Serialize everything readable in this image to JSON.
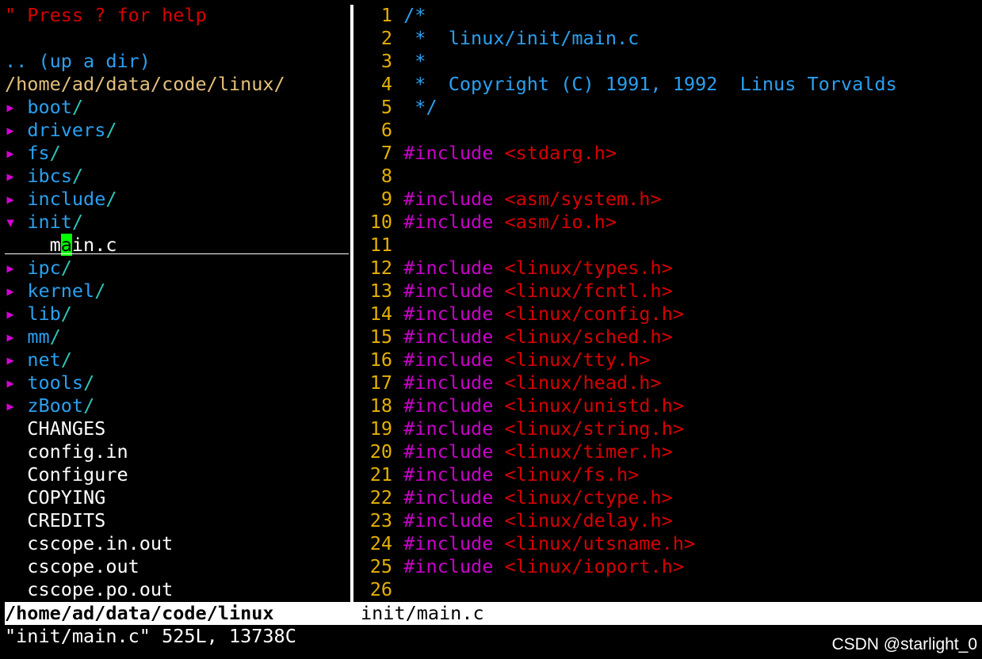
{
  "tree": {
    "help": "\" Press ? for help",
    "up_dir": ".. (up a dir)",
    "root_path": "/home/ad/data/code/linux/",
    "arrow_collapsed": "▸",
    "arrow_expanded": "▾",
    "entries": [
      {
        "kind": "dir",
        "name": "boot",
        "arrow": "▸"
      },
      {
        "kind": "dir",
        "name": "drivers",
        "arrow": "▸"
      },
      {
        "kind": "dir",
        "name": "fs",
        "arrow": "▸"
      },
      {
        "kind": "dir",
        "name": "ibcs",
        "arrow": "▸"
      },
      {
        "kind": "dir",
        "name": "include",
        "arrow": "▸"
      },
      {
        "kind": "dir",
        "name": "init",
        "arrow": "▾"
      },
      {
        "kind": "child",
        "name_pre": "m",
        "name_cursor": "a",
        "name_post": "in.c"
      },
      {
        "kind": "dir",
        "name": "ipc",
        "arrow": "▸"
      },
      {
        "kind": "dir",
        "name": "kernel",
        "arrow": "▸"
      },
      {
        "kind": "dir",
        "name": "lib",
        "arrow": "▸"
      },
      {
        "kind": "dir",
        "name": "mm",
        "arrow": "▸"
      },
      {
        "kind": "dir",
        "name": "net",
        "arrow": "▸"
      },
      {
        "kind": "dir",
        "name": "tools",
        "arrow": "▸"
      },
      {
        "kind": "dir",
        "name": "zBoot",
        "arrow": "▸"
      },
      {
        "kind": "file",
        "name": "CHANGES"
      },
      {
        "kind": "file",
        "name": "config.in"
      },
      {
        "kind": "file",
        "name": "Configure"
      },
      {
        "kind": "file",
        "name": "COPYING"
      },
      {
        "kind": "file",
        "name": "CREDITS"
      },
      {
        "kind": "file",
        "name": "cscope.in.out"
      },
      {
        "kind": "file",
        "name": "cscope.out"
      },
      {
        "kind": "file",
        "name": "cscope.po.out"
      }
    ]
  },
  "editor": {
    "lines": [
      {
        "n": "1",
        "t": "comment",
        "text": "/*"
      },
      {
        "n": "2",
        "t": "comment",
        "text": " *  linux/init/main.c"
      },
      {
        "n": "3",
        "t": "comment",
        "text": " *"
      },
      {
        "n": "4",
        "t": "comment",
        "text": " *  Copyright (C) 1991, 1992  Linus Torvalds"
      },
      {
        "n": "5",
        "t": "comment",
        "text": " */"
      },
      {
        "n": "6",
        "t": "blank",
        "text": ""
      },
      {
        "n": "7",
        "t": "include",
        "kw": "#include",
        "hdr": "<stdarg.h>"
      },
      {
        "n": "8",
        "t": "blank",
        "text": ""
      },
      {
        "n": "9",
        "t": "include",
        "kw": "#include",
        "hdr": "<asm/system.h>"
      },
      {
        "n": "10",
        "t": "include",
        "kw": "#include",
        "hdr": "<asm/io.h>"
      },
      {
        "n": "11",
        "t": "blank",
        "text": ""
      },
      {
        "n": "12",
        "t": "include",
        "kw": "#include",
        "hdr": "<linux/types.h>"
      },
      {
        "n": "13",
        "t": "include",
        "kw": "#include",
        "hdr": "<linux/fcntl.h>"
      },
      {
        "n": "14",
        "t": "include",
        "kw": "#include",
        "hdr": "<linux/config.h>"
      },
      {
        "n": "15",
        "t": "include",
        "kw": "#include",
        "hdr": "<linux/sched.h>"
      },
      {
        "n": "16",
        "t": "include",
        "kw": "#include",
        "hdr": "<linux/tty.h>"
      },
      {
        "n": "17",
        "t": "include",
        "kw": "#include",
        "hdr": "<linux/head.h>"
      },
      {
        "n": "18",
        "t": "include",
        "kw": "#include",
        "hdr": "<linux/unistd.h>"
      },
      {
        "n": "19",
        "t": "include",
        "kw": "#include",
        "hdr": "<linux/string.h>"
      },
      {
        "n": "20",
        "t": "include",
        "kw": "#include",
        "hdr": "<linux/timer.h>"
      },
      {
        "n": "21",
        "t": "include",
        "kw": "#include",
        "hdr": "<linux/fs.h>"
      },
      {
        "n": "22",
        "t": "include",
        "kw": "#include",
        "hdr": "<linux/ctype.h>"
      },
      {
        "n": "23",
        "t": "include",
        "kw": "#include",
        "hdr": "<linux/delay.h>"
      },
      {
        "n": "24",
        "t": "include",
        "kw": "#include",
        "hdr": "<linux/utsname.h>"
      },
      {
        "n": "25",
        "t": "include",
        "kw": "#include",
        "hdr": "<linux/ioport.h>"
      },
      {
        "n": "26",
        "t": "blank",
        "text": ""
      }
    ]
  },
  "status": {
    "left": "/home/ad/data/code/linux",
    "right": "init/main.c"
  },
  "cmdline": "\"init/main.c\" 525L, 13738C",
  "watermark": "CSDN @starlight_0",
  "colors": {
    "background": "#000000",
    "dir": "#2aa0f0",
    "line_number": "#e5b100",
    "include_keyword": "#c800c8",
    "header": "#d70000",
    "cursor": "#00ff00"
  }
}
